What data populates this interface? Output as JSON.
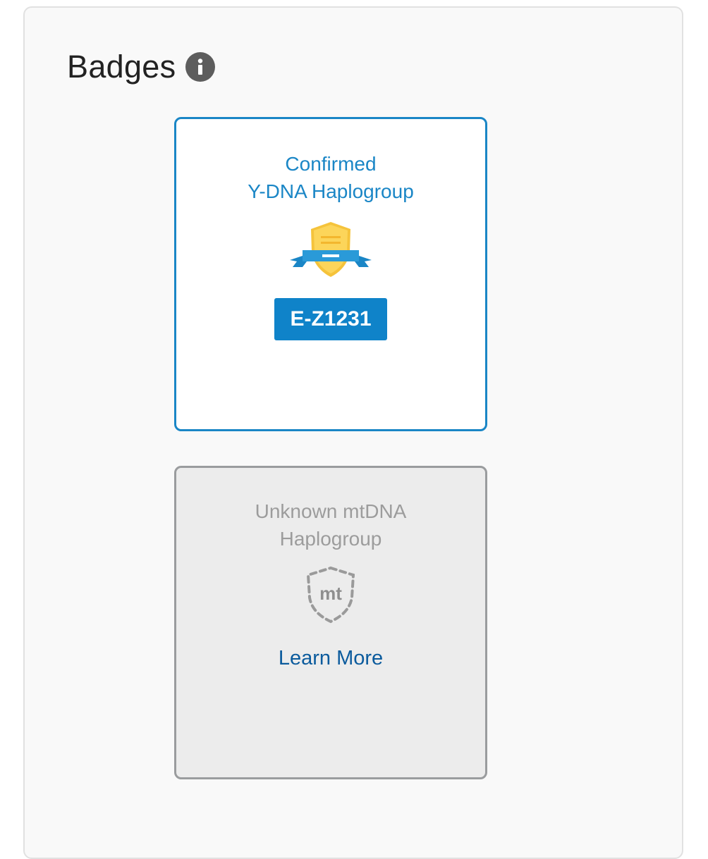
{
  "panel": {
    "title": "Badges",
    "info_icon": "info-icon"
  },
  "badges": [
    {
      "title_line1": "Confirmed",
      "title_line2": "Y-DNA Haplogroup",
      "icon": "gold-shield-ribbon-icon",
      "haplogroup": "E-Z1231",
      "accent_color": "#1a86c6"
    },
    {
      "title_line1": "Unknown mtDNA",
      "title_line2": "Haplogroup",
      "icon": "dashed-shield-icon",
      "icon_text": "mt",
      "link_label": "Learn More",
      "border_color": "#9a9c9e"
    }
  ]
}
